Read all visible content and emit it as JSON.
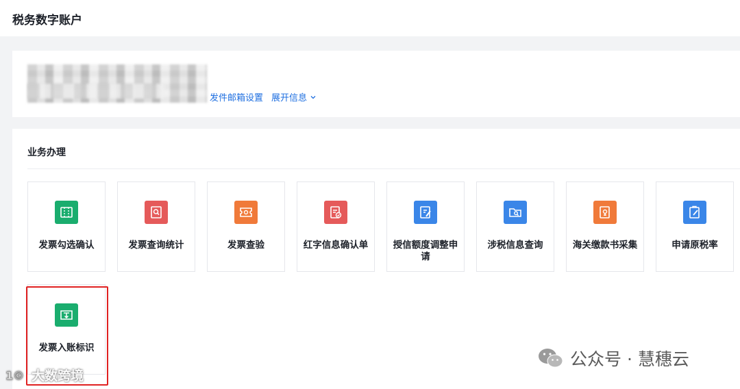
{
  "header": {
    "title": "税务数字账户"
  },
  "account": {
    "mail_settings_label": "发件邮箱设置",
    "expand_info_label": "展开信息"
  },
  "business": {
    "section_title": "业务办理",
    "items": [
      {
        "label": "发票勾选确认",
        "icon": "ticket-select-icon",
        "color": "#1aad6e"
      },
      {
        "label": "发票查询统计",
        "icon": "document-search-icon",
        "color": "#e55a5a"
      },
      {
        "label": "发票查验",
        "icon": "ticket-verify-icon",
        "color": "#f07a3a"
      },
      {
        "label": "红字信息确认单",
        "icon": "document-check-icon",
        "color": "#e55a5a"
      },
      {
        "label": "授信额度调整申请",
        "icon": "document-edit-icon",
        "color": "#3a86e8"
      },
      {
        "label": "涉税信息查询",
        "icon": "folder-search-icon",
        "color": "#3a86e8"
      },
      {
        "label": "海关缴款书采集",
        "icon": "document-collect-icon",
        "color": "#f07a3a"
      },
      {
        "label": "申请原税率",
        "icon": "clipboard-edit-icon",
        "color": "#3a86e8"
      },
      {
        "label": "发票入账标识",
        "icon": "ticket-download-icon",
        "color": "#1aad6e"
      }
    ]
  },
  "watermarks": {
    "right": "公众号 · 慧穗云",
    "left": "大数跨境"
  },
  "colors": {
    "accent": "#1f6fe0",
    "highlight_border": "#e02020"
  }
}
